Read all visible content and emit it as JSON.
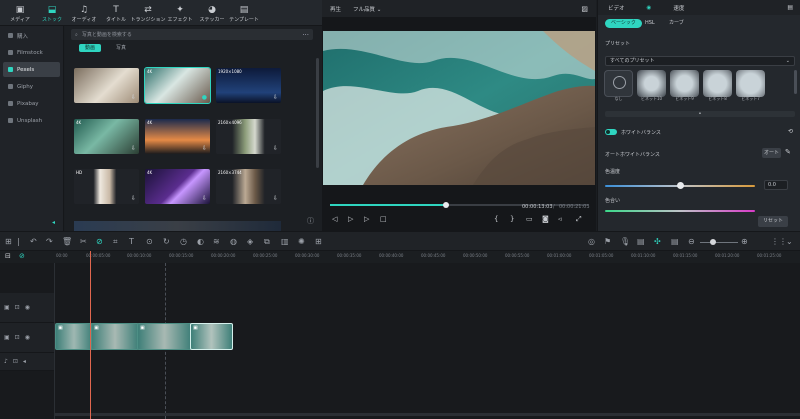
{
  "toolbar": {
    "items": [
      {
        "label": "メディア",
        "icon": "media-icon"
      },
      {
        "label": "ストック",
        "icon": "stock-icon"
      },
      {
        "label": "オーディオ",
        "icon": "audio-icon"
      },
      {
        "label": "タイトル",
        "icon": "title-icon"
      },
      {
        "label": "トランジション",
        "icon": "transition-icon"
      },
      {
        "label": "エフェクト",
        "icon": "effect-icon"
      },
      {
        "label": "ステッカー",
        "icon": "sticker-icon"
      },
      {
        "label": "テンプレート",
        "icon": "template-icon"
      }
    ],
    "active_index": 1
  },
  "sidebar": {
    "items": [
      {
        "label": "購入"
      },
      {
        "label": "Filmstock"
      },
      {
        "label": "Pexels"
      },
      {
        "label": "Giphy"
      },
      {
        "label": "Pixabay"
      },
      {
        "label": "Unsplash"
      }
    ],
    "active_index": 2
  },
  "media": {
    "search_placeholder": "写真と動画を検索する",
    "chips": [
      "動画",
      "写真"
    ],
    "thumbs": [
      {
        "res": ""
      },
      {
        "res": "4K"
      },
      {
        "res": "1920×1080"
      },
      {
        "res": "4K"
      },
      {
        "res": "4K"
      },
      {
        "res": "2160×4096"
      },
      {
        "res": "HD"
      },
      {
        "res": "4K"
      },
      {
        "res": "2160×3744"
      }
    ]
  },
  "player": {
    "tabs": [
      "再生",
      "フル品質"
    ],
    "time_current": "00:00:13:03",
    "time_total": "00:00:21:03",
    "progress": 0.45
  },
  "inspector": {
    "tabs": [
      "ビデオ",
      "",
      "速度"
    ],
    "subtabs": [
      "ベーシック",
      "HSL",
      "カーブ"
    ],
    "preset_title": "プリセット",
    "preset_select": "すべてのプリセット",
    "presets": [
      "なし",
      "ビネット10",
      "ビネット9",
      "ビネット8",
      "ビネット7"
    ],
    "white_balance": "ホワイトバランス",
    "auto_wb": "オートホワイトバランス",
    "auto_btn": "オート",
    "temperature_label": "色温度",
    "temperature_value": "0.0",
    "tint_label": "色合い",
    "reset": "リセット"
  },
  "timeline": {
    "ticks": [
      "00:00",
      "00:00:05:00",
      "00:00:10:00",
      "00:00:15:00",
      "00:00:20:00",
      "00:00:25:00",
      "00:00:30:00",
      "00:00:35:00",
      "00:00:40:00",
      "00:00:45:00",
      "00:00:50:00",
      "00:00:55:00",
      "00:01:00:00",
      "00:01:05:00",
      "00:01:10:00",
      "00:01:15:00",
      "00:01:20:00",
      "00:01:25:00"
    ]
  },
  "colors": {
    "accent": "#2fd5c0",
    "playhead": "#e0674f"
  }
}
